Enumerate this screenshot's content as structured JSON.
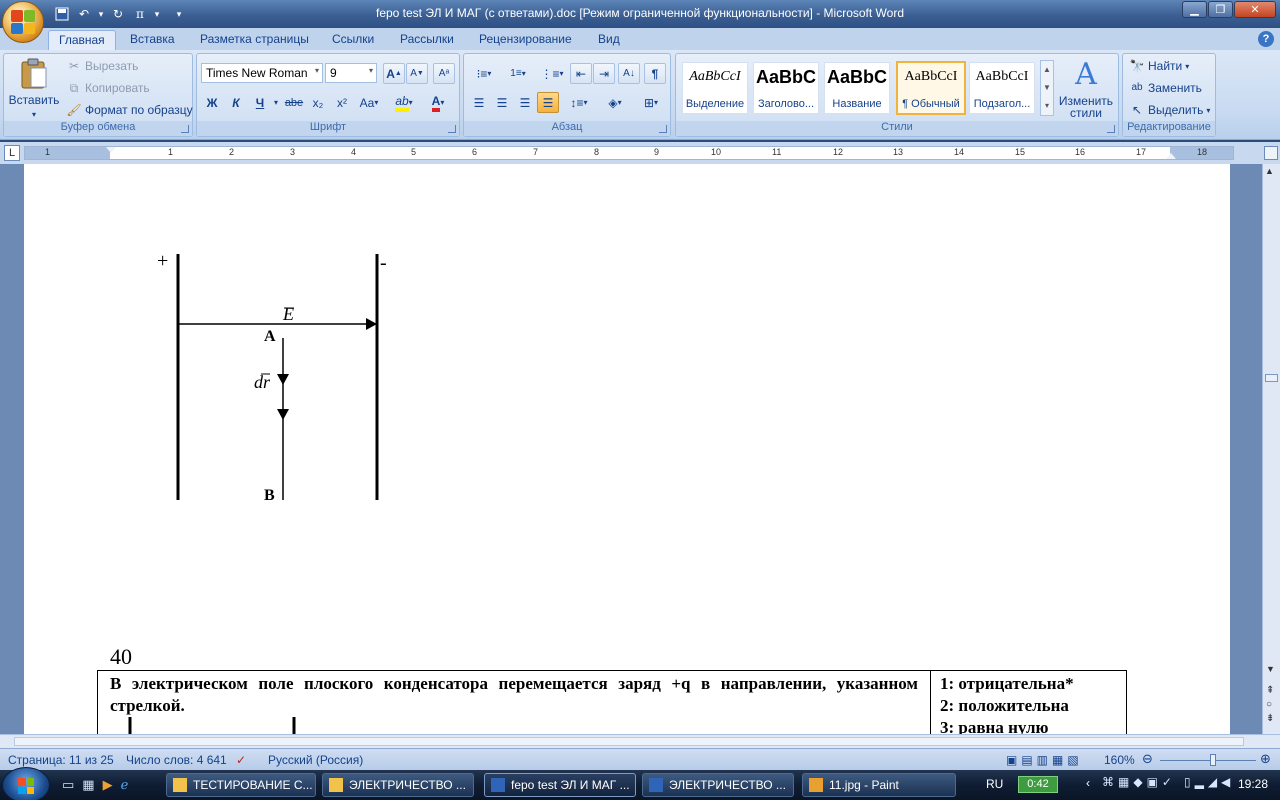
{
  "window": {
    "title": "fepo test ЭЛ И МАГ (с ответами).doc [Режим ограниченной функциональности] - Microsoft Word",
    "controls": {
      "minimize": "▁",
      "maximize": "❐",
      "close": "✕"
    }
  },
  "quick_access": {
    "undo_arrow": "▾",
    "more": "▾"
  },
  "ribbon_tabs": [
    "Главная",
    "Вставка",
    "Разметка страницы",
    "Ссылки",
    "Рассылки",
    "Рецензирование",
    "Вид"
  ],
  "help_label": "?",
  "clipboard": {
    "paste": "Вставить",
    "cut": "Вырезать",
    "copy": "Копировать",
    "format_painter": "Формат по образцу",
    "group_label": "Буфер обмена"
  },
  "font": {
    "name": "Times New Roman",
    "size": "9",
    "group_label": "Шрифт",
    "bold": "Ж",
    "italic": "К",
    "underline": "Ч",
    "strike": "abe",
    "subscript": "x₂",
    "superscript": "x²",
    "change_case": "Aa",
    "grow": "A",
    "shrink": "A",
    "highlight": "ab",
    "color": "A"
  },
  "paragraph": {
    "group_label": "Абзац",
    "pilcrow": "¶"
  },
  "styles": {
    "group_label": "Стили",
    "items": [
      {
        "sample": "AaBbCcI",
        "name": "Выделение"
      },
      {
        "sample": "AaBbC",
        "name": "Заголово..."
      },
      {
        "sample": "AaBbC",
        "name": "Название"
      },
      {
        "sample": "AaBbCcI",
        "name": "¶ Обычный"
      },
      {
        "sample": "AaBbCcI",
        "name": "Подзагол..."
      }
    ],
    "change_styles": "Изменить стили"
  },
  "editing": {
    "group_label": "Редактирование",
    "find": "Найти",
    "replace": "Заменить",
    "select": "Выделить"
  },
  "ruler": {
    "corner": "L",
    "left_numbers": [
      "1"
    ],
    "numbers": [
      "1",
      "2",
      "3",
      "4",
      "5",
      "6",
      "7",
      "8",
      "9",
      "10",
      "11",
      "12",
      "13",
      "14",
      "15",
      "16",
      "17",
      "18"
    ]
  },
  "figure": {
    "plus": "+",
    "minus": "-",
    "field_label": "E",
    "point_a": "A",
    "point_b": "B",
    "displacement_label": "dr"
  },
  "question": {
    "number": "40",
    "text": "В электрическом поле плоского конденсатора перемещается заряд +q в направлении, указанном стрелкой.",
    "answers": [
      "1: отрицательна*",
      "2: положительна",
      "3: равна нулю"
    ]
  },
  "status": {
    "page": "Страница: 11 из 25",
    "words": "Число слов: 4 641",
    "language": "Русский (Россия)",
    "zoom": "160%"
  },
  "taskbar": {
    "tasks": [
      {
        "label": "ТЕСТИРОВАНИЕ С...",
        "icon": "folder-icon"
      },
      {
        "label": "ЭЛЕКТРИЧЕСТВО ...",
        "icon": "folder-icon"
      },
      {
        "label": "fepo test ЭЛ И МАГ ...",
        "icon": "word-icon"
      },
      {
        "label": "ЭЛЕКТРИЧЕСТВО ...",
        "icon": "word-icon"
      },
      {
        "label": "11.jpg - Paint",
        "icon": "paint-icon"
      }
    ],
    "lang": "RU",
    "battery": "0:42",
    "clock": "19:28"
  }
}
